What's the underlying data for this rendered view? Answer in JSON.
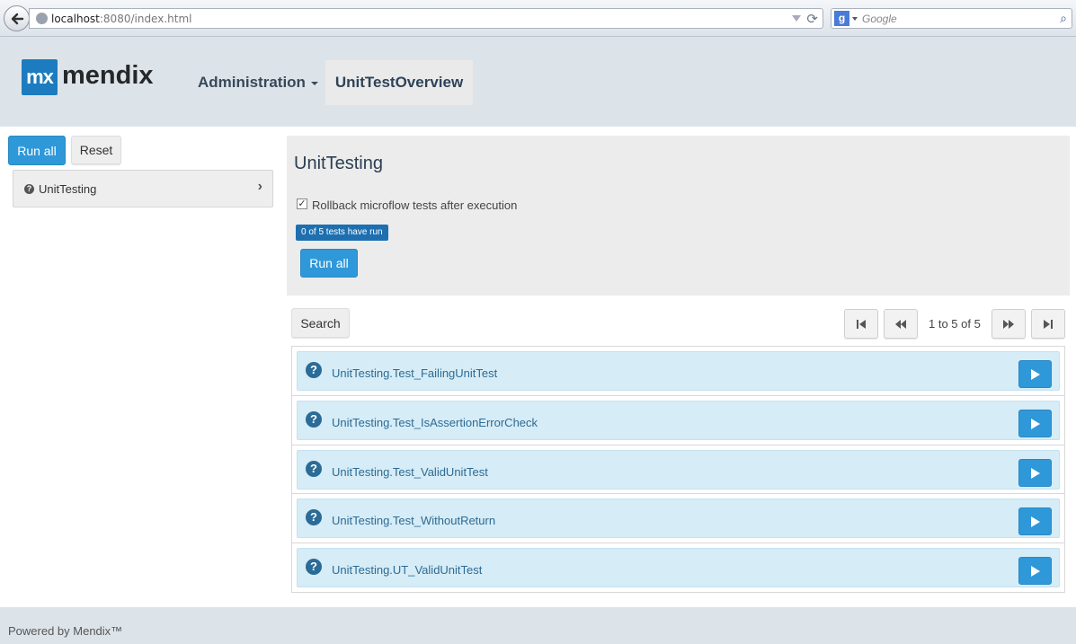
{
  "browser": {
    "url_host": "localhost",
    "url_rest": ":8080/index.html",
    "search_engine_letter": "g",
    "search_placeholder": "Google"
  },
  "header": {
    "logo_mark": "mx",
    "logo_text": "mendix",
    "nav_admin": "Administration",
    "nav_active": "UnitTestOverview",
    "bg_color": "#dde4e9"
  },
  "sidebar": {
    "run_all_label": "Run all",
    "reset_label": "Reset",
    "tree_items": [
      {
        "label": "UnitTesting",
        "status_icon": "question-circle-icon"
      }
    ]
  },
  "panel": {
    "title": "UnitTesting",
    "rollback_label": "Rollback microflow tests after execution",
    "rollback_checked": true,
    "progress_badge": "0 of 5 tests have run",
    "run_all_label": "Run all"
  },
  "list_controls": {
    "search_label": "Search",
    "pager_text": "1 to 5 of 5"
  },
  "tests": [
    {
      "name": "UnitTesting.Test_FailingUnitTest",
      "status_icon": "question-circle-icon"
    },
    {
      "name": "UnitTesting.Test_IsAssertionErrorCheck",
      "status_icon": "question-circle-icon"
    },
    {
      "name": "UnitTesting.Test_ValidUnitTest",
      "status_icon": "question-circle-icon"
    },
    {
      "name": "UnitTesting.Test_WithoutReturn",
      "status_icon": "question-circle-icon"
    },
    {
      "name": "UnitTesting.UT_ValidUnitTest",
      "status_icon": "question-circle-icon"
    }
  ],
  "footer": {
    "text": "Powered by Mendix™"
  },
  "colors": {
    "primary": "#2f98d8",
    "row_bg": "#d6ecf6",
    "badge": "#1e6fb0"
  }
}
